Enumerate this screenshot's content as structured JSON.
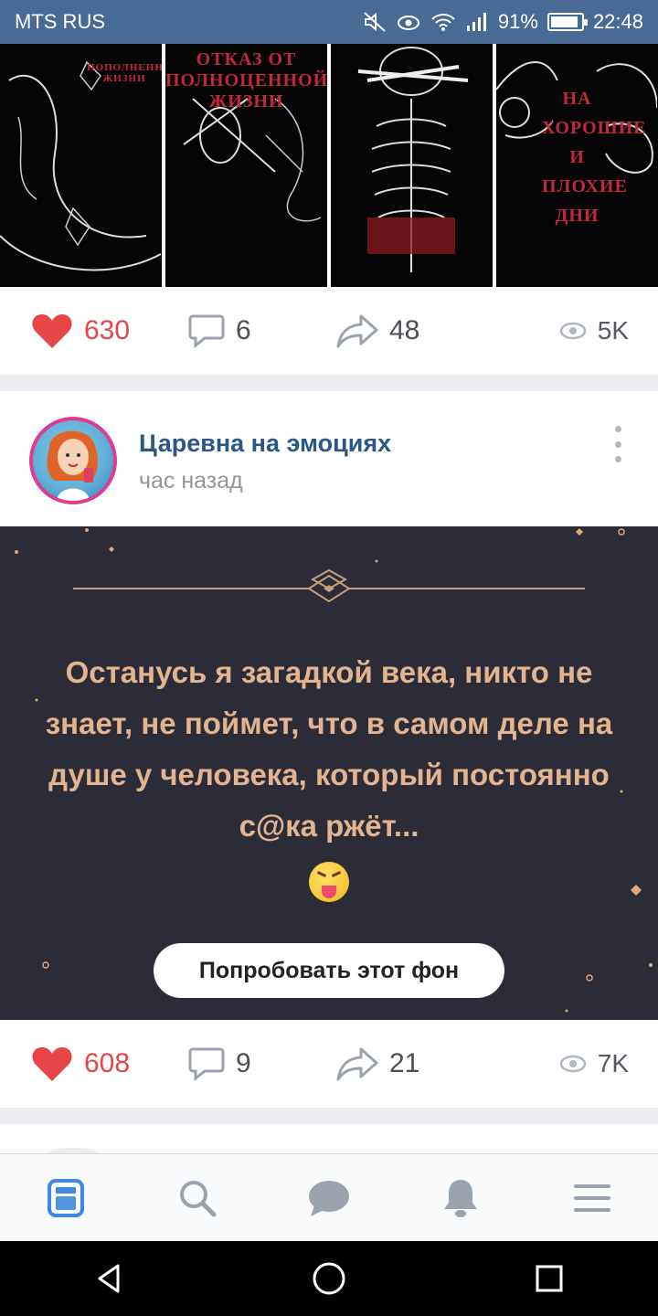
{
  "status_bar": {
    "carrier": "MTS RUS",
    "battery": "91%",
    "battery_level": 0.91,
    "time": "22:48",
    "icons": [
      "mute-icon",
      "eye-icon",
      "wifi-icon",
      "signal-icon",
      "battery-icon"
    ]
  },
  "gallery": {
    "images": [
      {
        "caption": "ПОПОЛНЕННОЙ ЖИЗНИ",
        "accent": "#c3283a"
      },
      {
        "caption": "ОТКАЗ ОТ ПОЛНОЦЕННОЙ ЖИЗНИ",
        "accent": "#c3283a"
      },
      {
        "caption": "",
        "accent": "#c3283a"
      },
      {
        "caption": "НА ХОРОШИЕ И ПЛОХИЕ ДНИ",
        "accent": "#c3283a"
      }
    ]
  },
  "post1": {
    "likes": "630",
    "comments": "6",
    "shares": "48",
    "views": "5K"
  },
  "post2": {
    "author": "Царевна на эмоциях",
    "time": "час назад",
    "text": "Останусь я загадкой века, никто не знает, не поймет, что в самом деле на душе у человека, который постоянно с@ка ржёт...",
    "emoji": "squinting-face-with-tongue",
    "try_button": "Попробовать этот фон",
    "likes": "608",
    "comments": "9",
    "shares": "21",
    "views": "7K",
    "bg_color": "#2c2c38",
    "text_color": "#e2b48f"
  },
  "tabbar": {
    "tabs": [
      {
        "icon": "news-icon",
        "active": true
      },
      {
        "icon": "search-icon",
        "active": false
      },
      {
        "icon": "messages-icon",
        "active": false
      },
      {
        "icon": "bell-icon",
        "active": false
      },
      {
        "icon": "menu-icon",
        "active": false
      }
    ]
  },
  "colors": {
    "accent": "#2a5885",
    "like": "#e64646",
    "status_bar": "#4a6a96"
  }
}
